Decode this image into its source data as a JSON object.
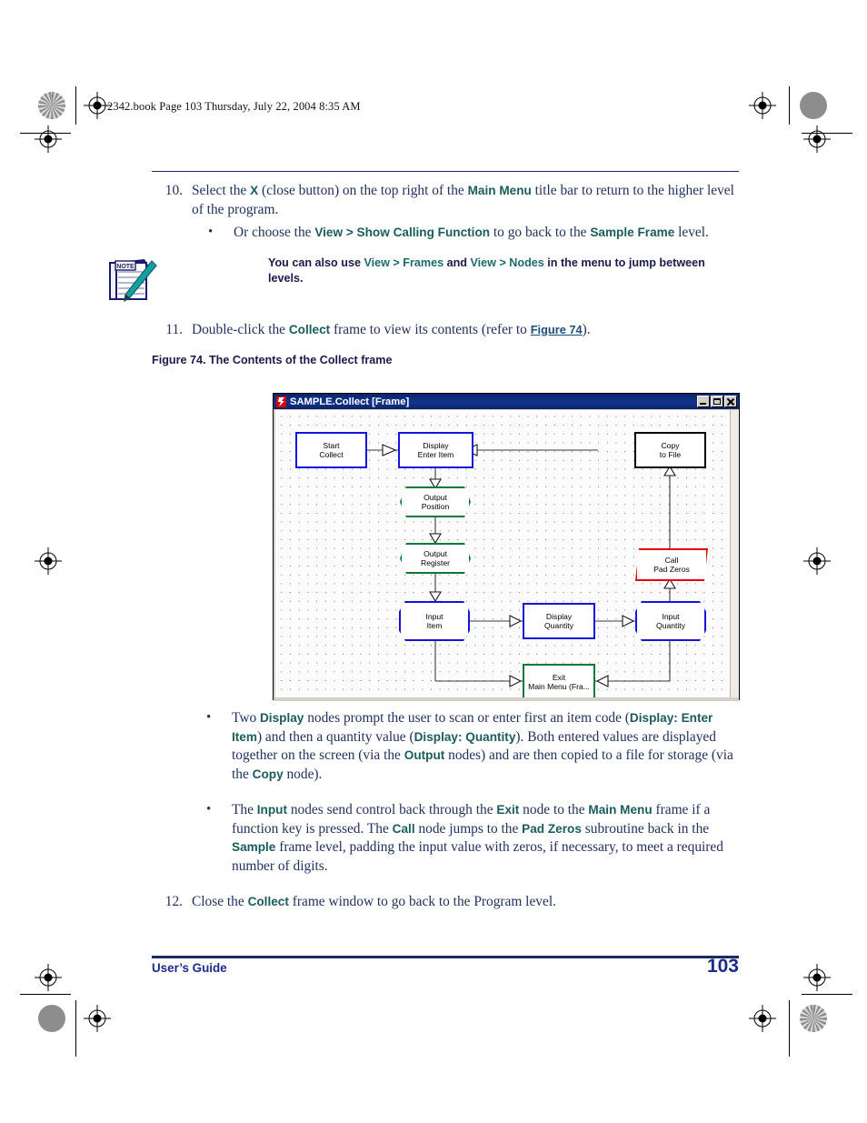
{
  "printer_marks": {
    "present": true
  },
  "book_header": "2342.book  Page 103  Thursday, July 22, 2004  8:35 AM",
  "steps": {
    "step10": {
      "number": "10.",
      "seg1": "Select the ",
      "kw1": "X",
      "seg2": " (close button) on the top right of the ",
      "kw2": "Main Menu",
      "seg3": " title bar to return to the higher level of the program.",
      "bullet": {
        "marker": "•",
        "seg1": "Or choose the ",
        "kw1": "View > Show Calling Function",
        "seg2": " to go back to the ",
        "kw2": "Sample Frame",
        "seg3": " level."
      }
    },
    "step11": {
      "number": "11.",
      "seg1": "Double-click the ",
      "kw1": "Collect",
      "seg2": " frame to view its contents (refer to ",
      "link": "Figure 74",
      "seg3": ")."
    },
    "step12": {
      "number": "12.",
      "seg1": "Close the ",
      "kw1": "Collect",
      "seg2": " frame window to go back to the Program level."
    }
  },
  "note": {
    "icon": "note-pad-pencil-icon",
    "icon_label": "NOTE",
    "seg1": "You can also use ",
    "kw1": "View > Frames",
    "seg2": " and ",
    "kw2": "View > Nodes",
    "seg3": " in the menu to jump between levels."
  },
  "figure": {
    "caption": "Figure 74. The Contents of the Collect frame",
    "window": {
      "title": "SAMPLE.Collect [Frame]",
      "icon": "red-flag-app-icon",
      "buttons": {
        "minimize": "Minimize",
        "maximize": "Maximize",
        "close": "Close"
      }
    },
    "nodes": [
      {
        "id": "start-collect",
        "line1": "Start",
        "line2": "Collect",
        "shape": "rect",
        "color": "#1414dc"
      },
      {
        "id": "display-enter-item",
        "line1": "Display",
        "line2": "Enter Item",
        "shape": "rect",
        "color": "#1414dc"
      },
      {
        "id": "copy-to-file",
        "line1": "Copy",
        "line2": "to File",
        "shape": "rect",
        "color": "#000000"
      },
      {
        "id": "output-position",
        "line1": "Output",
        "line2": "Position",
        "shape": "hexagon",
        "color": "#0a7a38"
      },
      {
        "id": "output-register",
        "line1": "Output",
        "line2": "Register",
        "shape": "hexagon",
        "color": "#0a7a38"
      },
      {
        "id": "call-pad-zeros",
        "line1": "Call",
        "line2": "Pad Zeros",
        "shape": "parallelogram",
        "color": "#ee0000"
      },
      {
        "id": "input-item",
        "line1": "Input",
        "line2": "Item",
        "shape": "octagon",
        "color": "#1414dc"
      },
      {
        "id": "display-quantity",
        "line1": "Display",
        "line2": "Quantity",
        "shape": "rect",
        "color": "#1414dc"
      },
      {
        "id": "input-quantity",
        "line1": "Input",
        "line2": "Quantity",
        "shape": "octagon",
        "color": "#1414dc"
      },
      {
        "id": "exit-main-menu",
        "line1": "Exit",
        "line2": "Main Menu (Fra...",
        "shape": "rect",
        "color": "#0a7a38"
      }
    ]
  },
  "bullets": [
    {
      "marker": "•",
      "seg1": "Two ",
      "kw1": "Display",
      "seg2": " nodes prompt the user to scan or enter first an item code (",
      "kw2": "Display: Enter Item",
      "seg3": ") and then a quantity value (",
      "kw3": "Display: Quantity",
      "seg4": "). Both entered values are displayed together on the screen (via the ",
      "kw4": "Output",
      "seg5": " nodes) and are then copied to a file for storage (via the ",
      "kw5": "Copy",
      "seg6": " node)."
    },
    {
      "marker": "•",
      "seg1": "The ",
      "kw1": "Input",
      "seg2": " nodes send control back through the ",
      "kw2": "Exit",
      "seg3": " node to the ",
      "kw3": "Main Menu",
      "seg4": " frame if a function key is pressed. The ",
      "kw4": "Call",
      "seg5": " node jumps to the ",
      "kw5": "Pad Zeros",
      "seg6": " subroutine back in the ",
      "kw6": "Sample",
      "seg7": " frame level, padding the input value with zeros, if necessary, to meet a required number of digits."
    }
  ],
  "footer": {
    "left": "User’s Guide",
    "page": "103"
  },
  "colors": {
    "keyword_teal": "#17595b",
    "body_navy": "#23315f",
    "rule_navy": "#1b2a63",
    "footer_blue": "#1b2a8c",
    "titlebar_blue": "#0a246a"
  }
}
